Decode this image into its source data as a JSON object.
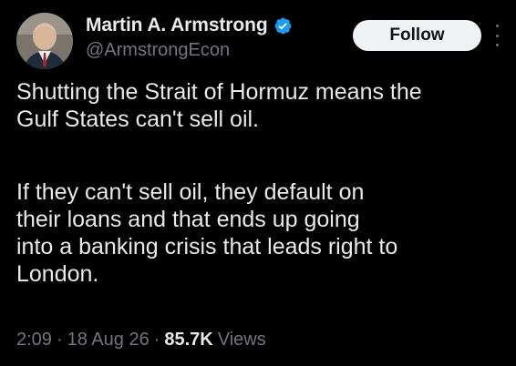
{
  "author": {
    "display_name": "Martin A. Armstrong",
    "handle": "@ArmstrongEcon",
    "verified": true,
    "verified_color": "#1d9bf0"
  },
  "actions": {
    "follow_label": "Follow",
    "more_icon": "more-vertical-icon"
  },
  "tweet": {
    "paragraph_1_lines": [
      "Shutting the Strait of Hormuz means the",
      "Gulf States can't sell oil."
    ],
    "paragraph_2_lines": [
      "If they can't sell oil, they default on",
      "their loans and that ends up going",
      "into a banking crisis that leads right to",
      "London."
    ]
  },
  "meta": {
    "time": "2:09",
    "separator": "·",
    "date": "18 Aug 26",
    "views_count": "85.7K",
    "views_label": "Views"
  },
  "colors": {
    "background": "#000000",
    "primary_text": "#e7e9ea",
    "secondary_text": "#71767b",
    "follow_button_bg": "#eff3f4",
    "follow_button_text": "#0f1419"
  }
}
